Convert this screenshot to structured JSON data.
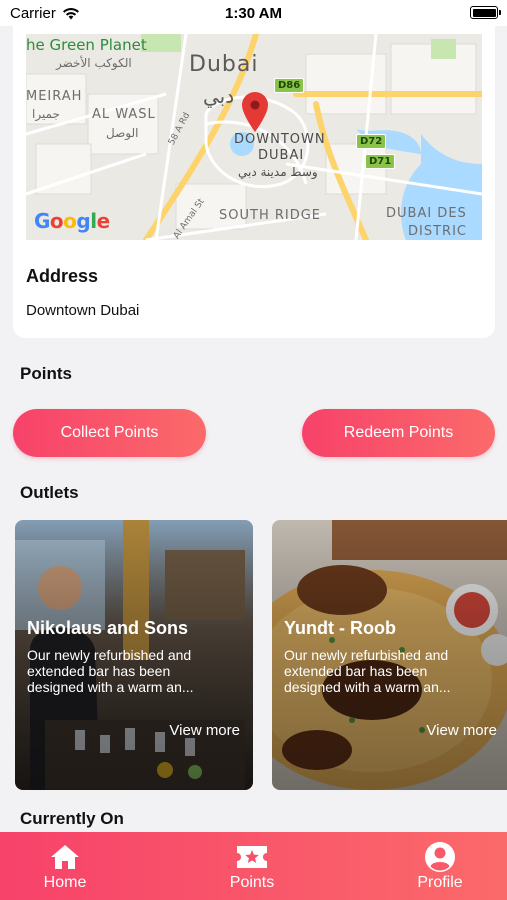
{
  "status_bar": {
    "carrier": "Carrier",
    "time": "1:30 AM",
    "battery_level": 1.0
  },
  "map": {
    "labels": {
      "green_planet": "he Green Planet",
      "green_planet_ar": "الكوكب الأخضر",
      "city": "Dubai",
      "city_ar": "دبي",
      "jumeirah": "MEIRAH",
      "jumeirah_ar": "جميرا",
      "al_wasl": "AL WASL",
      "al_wasl_ar": "الوصل",
      "downtown_1": "DOWNTOWN",
      "downtown_2": "DUBAI",
      "downtown_ar": "وسط مدينة دبي",
      "south_ridge": "SOUTH RIDGE",
      "dubai_design_1": "DUBAI DES",
      "dubai_design_2": "DISTRIC",
      "road_58a": "58 A Rd",
      "road_al_amal": "Al Amal St"
    },
    "shields": [
      "D86",
      "D72",
      "D71"
    ],
    "attribution": "Google"
  },
  "address": {
    "title": "Address",
    "value": "Downtown Dubai"
  },
  "points": {
    "title": "Points",
    "collect_label": "Collect Points",
    "redeem_label": "Redeem Points"
  },
  "outlets": {
    "title": "Outlets",
    "items": [
      {
        "name": "Nikolaus and Sons",
        "description": "Our newly refurbished and extended bar has been designed with a warm an...",
        "more_label": "View more"
      },
      {
        "name": "Yundt - Roob",
        "description": "Our newly refurbished and extended bar has been designed with a warm an...",
        "more_label": "View more"
      }
    ]
  },
  "currently_on": {
    "title": "Currently On"
  },
  "tab_bar": {
    "items": [
      {
        "label": "Home",
        "icon": "home-icon"
      },
      {
        "label": "Points",
        "icon": "ticket-star-icon"
      },
      {
        "label": "Profile",
        "icon": "profile-icon"
      }
    ]
  },
  "colors": {
    "accent_start": "#f7426a",
    "accent_end": "#fb6a6a",
    "background": "#f2f2f4"
  }
}
